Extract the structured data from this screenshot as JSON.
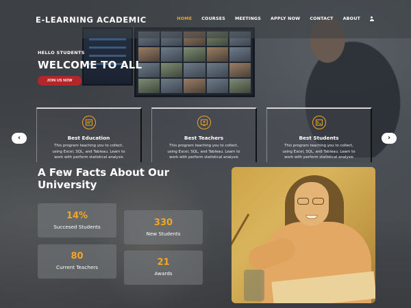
{
  "header": {
    "logo": "E-LEARNING ACADEMIC",
    "nav": [
      "HOME",
      "COURSES",
      "MEETINGS",
      "APPLY NOW",
      "CONTACT",
      "ABOUT"
    ],
    "active_nav": "HOME"
  },
  "hero": {
    "kicker": "HELLO STUDENTS",
    "title": "WELCOME TO ALL",
    "button": "JOIN US NOW"
  },
  "features": [
    {
      "icon": "education-icon",
      "title": "Best Education",
      "text": "This program teaching you to collect, using Excel, SQL, and Tableau. Learn to work with perform statistical analysis"
    },
    {
      "icon": "teachers-icon",
      "title": "Best Teachers",
      "text": "This program teaching you to collect, using Excel, SQL, and Tableau. Learn to work with perform statistical analysis"
    },
    {
      "icon": "students-icon",
      "title": "Best Students",
      "text": "This program teaching you to collect, using Excel, SQL, and Tableau. Learn to work with perform statistical analysis"
    }
  ],
  "facts": {
    "title": "A Few Facts About Our University",
    "stats": [
      {
        "value": "14%",
        "label": "Succesed Students"
      },
      {
        "value": "330",
        "label": "New Students"
      },
      {
        "value": "80",
        "label": "Current Teachers"
      },
      {
        "value": "21",
        "label": "Awards"
      }
    ]
  },
  "colors": {
    "accent": "#f5a623",
    "button": "#b5262b"
  }
}
